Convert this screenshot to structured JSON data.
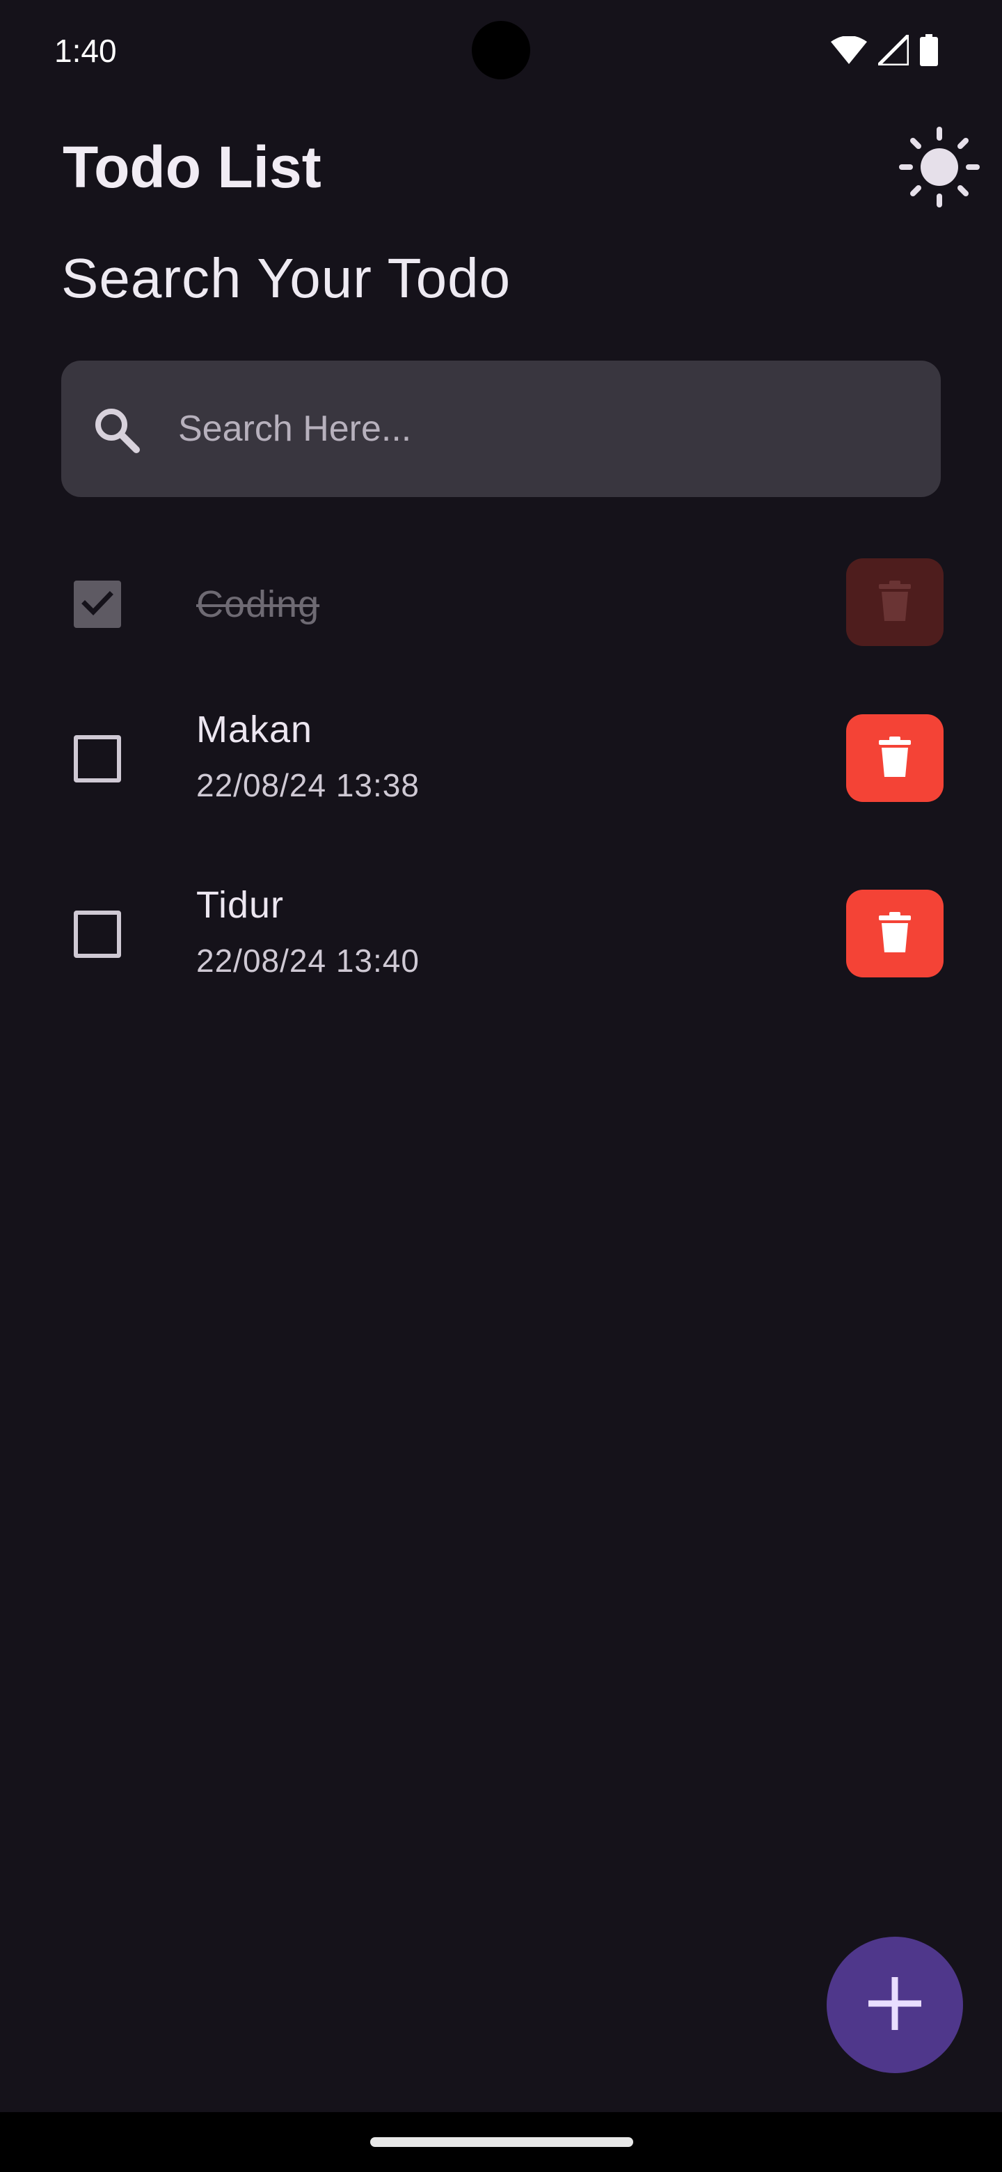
{
  "status_bar": {
    "time": "1:40",
    "icons": [
      "wifi-icon",
      "signal-icon",
      "battery-icon"
    ]
  },
  "header": {
    "title": "Todo List",
    "theme_icon": "sun-icon"
  },
  "search": {
    "title": "Search Your Todo",
    "placeholder": "Search Here...",
    "value": "",
    "icon": "search-icon"
  },
  "todos": [
    {
      "title": "Coding",
      "date": "",
      "done": true
    },
    {
      "title": "Makan",
      "date": "22/08/24 13:38",
      "done": false
    },
    {
      "title": "Tidur",
      "date": "22/08/24 13:40",
      "done": false
    }
  ],
  "fab": {
    "icon": "plus-icon"
  },
  "colors": {
    "background": "#15121a",
    "search_bg": "#39363f",
    "delete": "#f44336",
    "delete_faded": "#4e1d1d",
    "fab": "#4f378b",
    "text": "#ece6f0"
  }
}
